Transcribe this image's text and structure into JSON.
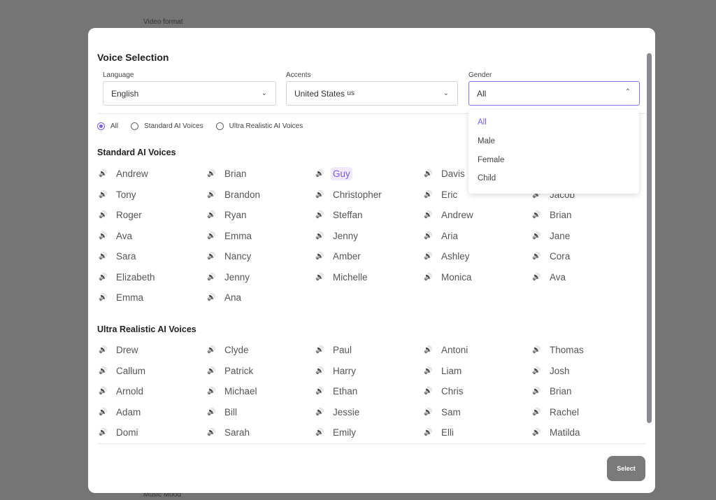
{
  "background": {
    "top_label": "Video format",
    "bottom_label": "Music Mood"
  },
  "modal": {
    "title": "Voice Selection",
    "language": {
      "label": "Language",
      "value": "English"
    },
    "accents": {
      "label": "Accents",
      "value": "United States",
      "code": "us"
    },
    "gender": {
      "label": "Gender",
      "value": "All",
      "options": [
        "All",
        "Male",
        "Female",
        "Child"
      ],
      "selected": "All"
    },
    "filters": [
      "All",
      "Standard AI Voices",
      "Ultra Realistic AI Voices"
    ],
    "filter_selected": "All",
    "standard": {
      "title": "Standard AI Voices",
      "voices": [
        "Andrew",
        "Brian",
        "Guy",
        "Davis",
        "",
        "Tony",
        "Brandon",
        "Christopher",
        "Eric",
        "Jacob",
        "Roger",
        "Ryan",
        "Steffan",
        "Andrew",
        "Brian",
        "Ava",
        "Emma",
        "Jenny",
        "Aria",
        "Jane",
        "Sara",
        "Nancy",
        "Amber",
        "Ashley",
        "Cora",
        "Elizabeth",
        "Jenny",
        "Michelle",
        "Monica",
        "Ava",
        "Emma",
        "Ana"
      ],
      "active": "Guy"
    },
    "ultra": {
      "title": "Ultra Realistic AI Voices",
      "voices": [
        "Drew",
        "Clyde",
        "Paul",
        "Antoni",
        "Thomas",
        "Callum",
        "Patrick",
        "Harry",
        "Liam",
        "Josh",
        "Arnold",
        "Michael",
        "Ethan",
        "Chris",
        "Brian",
        "Adam",
        "Bill",
        "Jessie",
        "Sam",
        "Rachel",
        "Domi",
        "Sarah",
        "Emily",
        "Elli",
        "Matilda"
      ]
    },
    "select_button": "Select",
    "accent_color": "#7b5ce6"
  }
}
